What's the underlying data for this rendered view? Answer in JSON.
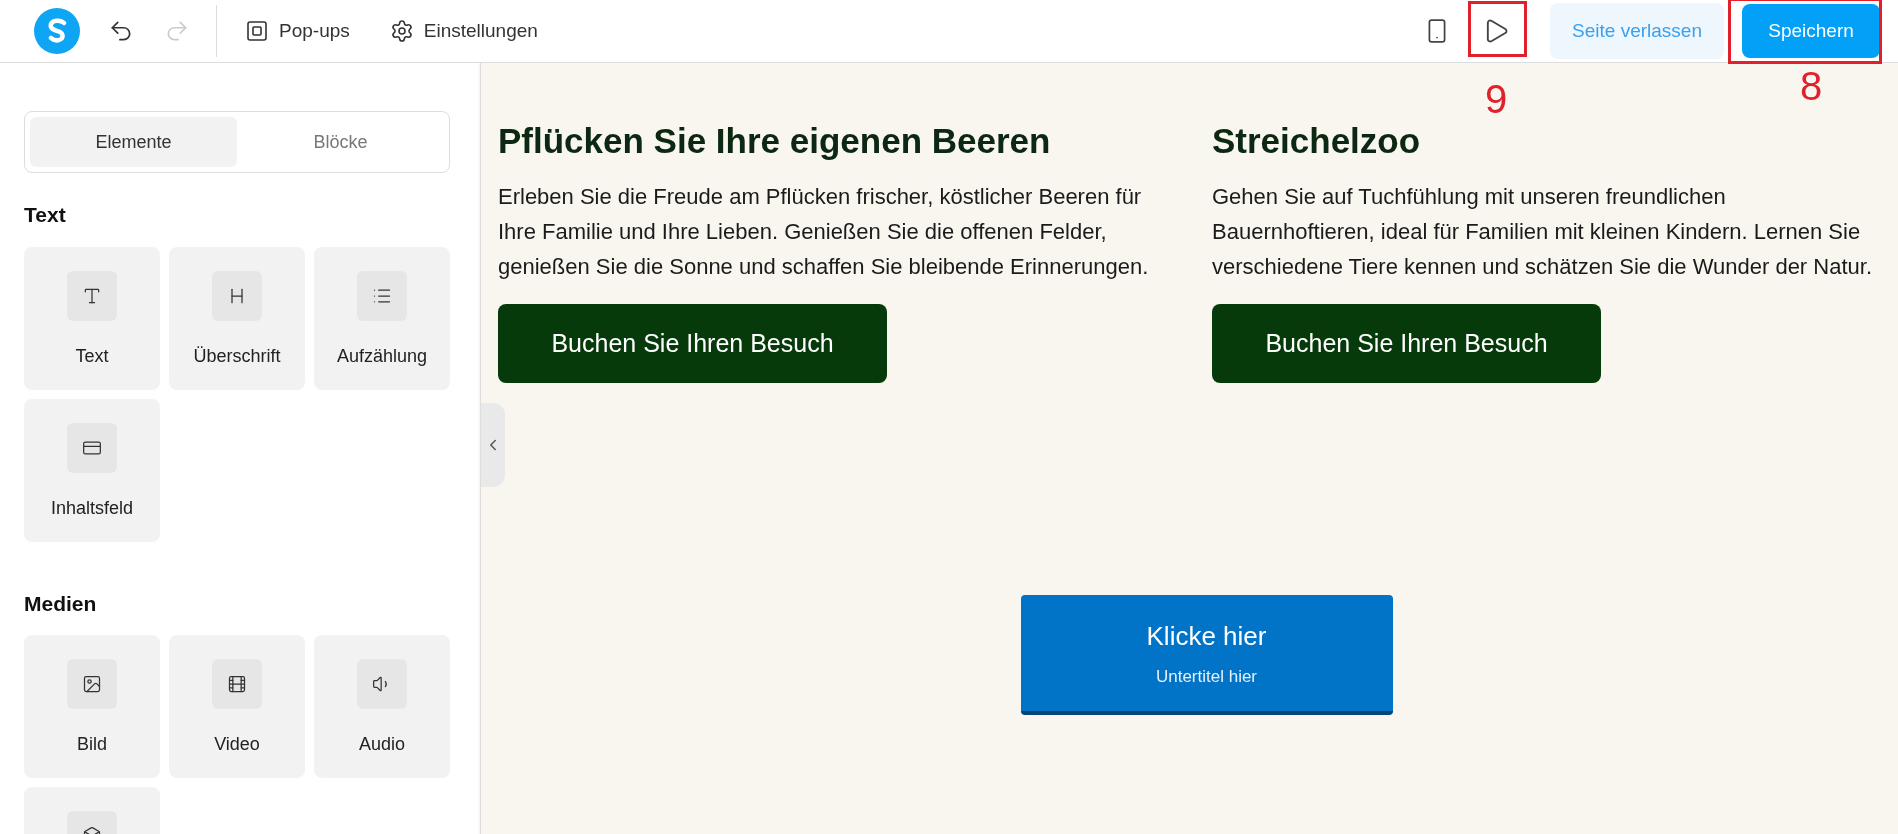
{
  "toolbar": {
    "history": [
      {
        "kind": "undo",
        "disabled": false
      },
      {
        "kind": "redo",
        "disabled": true
      }
    ],
    "nav": [
      {
        "kind": "popup",
        "label": "Pop-ups"
      },
      {
        "kind": "gear",
        "label": "Einstellungen"
      }
    ],
    "preview": {
      "annotation": "9"
    },
    "exit_button": {
      "label": "Seite verlassen"
    },
    "save_button": {
      "label": "Speichern",
      "annotation": "8"
    }
  },
  "sidebar": {
    "tabs": [
      {
        "label": "Elemente",
        "selected": true
      },
      {
        "label": "Blöcke",
        "selected": false
      }
    ],
    "sections": [
      {
        "title": "Text",
        "items": [
          {
            "kind": "text",
            "label": "Text"
          },
          {
            "kind": "heading",
            "label": "Überschrift"
          },
          {
            "kind": "list",
            "label": "Aufzählung"
          },
          {
            "kind": "box",
            "label": "Inhaltsfeld"
          }
        ]
      },
      {
        "title": "Medien",
        "items": [
          {
            "kind": "image",
            "label": "Bild"
          },
          {
            "kind": "video",
            "label": "Video"
          },
          {
            "kind": "audio",
            "label": "Audio"
          },
          {
            "kind": "embed"
          }
        ]
      }
    ]
  },
  "canvas": {
    "columns": [
      {
        "heading": "Pflücken Sie Ihre eigenen Beeren",
        "text": "Erleben Sie die Freude am Pflücken frischer, köstlicher Beeren für Ihre Familie und Ihre Lieben. Genießen Sie die offenen Felder, genießen Sie die Sonne und schaffen Sie bleibende Erinnerungen.",
        "button": "Buchen Sie Ihren Besuch"
      },
      {
        "heading": "Streichelzoo",
        "text": "Gehen Sie auf Tuchfühlung mit unseren freundlichen Bauernhoftieren, ideal für Familien mit kleinen Kindern. Lernen Sie verschiedene Tiere kennen und schätzen Sie die Wunder der Natur.",
        "button": "Buchen Sie Ihren Besuch"
      }
    ],
    "cta": {
      "title": "Klicke hier",
      "subtitle": "Untertitel hier"
    }
  }
}
